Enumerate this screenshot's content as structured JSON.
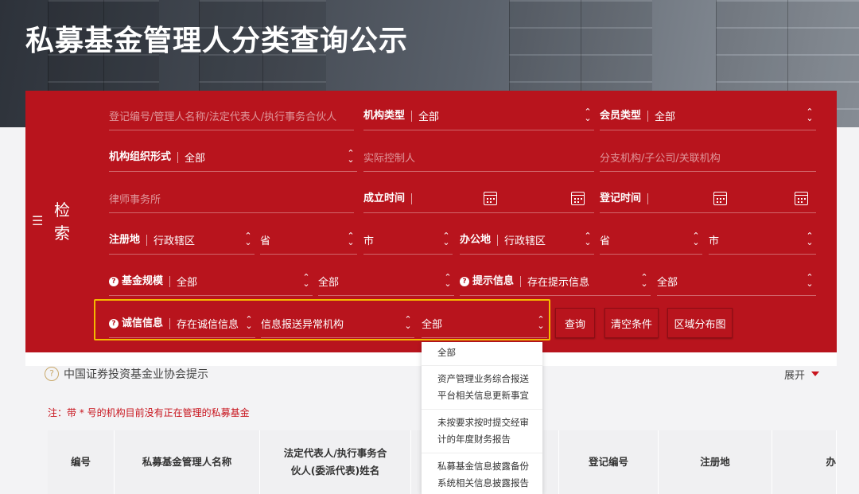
{
  "page_title": "私募基金管理人分类查询公示",
  "search_label": "检 索",
  "filters": {
    "keyword_placeholder": "登记编号/管理人名称/法定代表人/执行事务合伙人",
    "org_type_label": "机构类型",
    "org_type_value": "全部",
    "member_type_label": "会员类型",
    "member_type_value": "全部",
    "org_form_label": "机构组织形式",
    "org_form_value": "全部",
    "controller_placeholder": "实际控制人",
    "branch_placeholder": "分支机构/子公司/关联机构",
    "law_firm_placeholder": "律师事务所",
    "established_label": "成立时间",
    "registered_label": "登记时间",
    "reg_place_label": "注册地",
    "reg_place_value": "行政辖区",
    "reg_province": "省",
    "reg_city": "市",
    "office_label": "办公地",
    "office_value": "行政辖区",
    "office_province": "省",
    "office_city": "市",
    "fund_scale_label": "基金规模",
    "fund_scale_value": "全部",
    "fund_scale_value2": "全部",
    "hint_label": "提示信息",
    "hint_value": "存在提示信息",
    "hint_value2": "全部",
    "integrity_label": "诚信信息",
    "integrity_value": "存在诚信信息",
    "integrity_type": "信息报送异常机构",
    "integrity_sub": "全部"
  },
  "buttons": {
    "query": "查询",
    "clear": "清空条件",
    "region_map": "区域分布图"
  },
  "dropdown": {
    "items": [
      "全部",
      "资产管理业务综合报送平台相关信息更新事宜",
      "未按要求按时提交经审计的年度财务报告",
      "私募基金信息披露备份系统相关信息披露报告"
    ]
  },
  "notice": {
    "text": "中国证券投资基金业协会提示",
    "expand": "展开"
  },
  "note": "注：带 * 号的机构目前没有正在管理的私募基金",
  "table": {
    "headers": [
      "编号",
      "私募基金管理人名称",
      "法定代表人/执行事务合伙人(委派代表)姓名",
      "",
      "",
      "登记编号",
      "注册地",
      "办"
    ]
  }
}
